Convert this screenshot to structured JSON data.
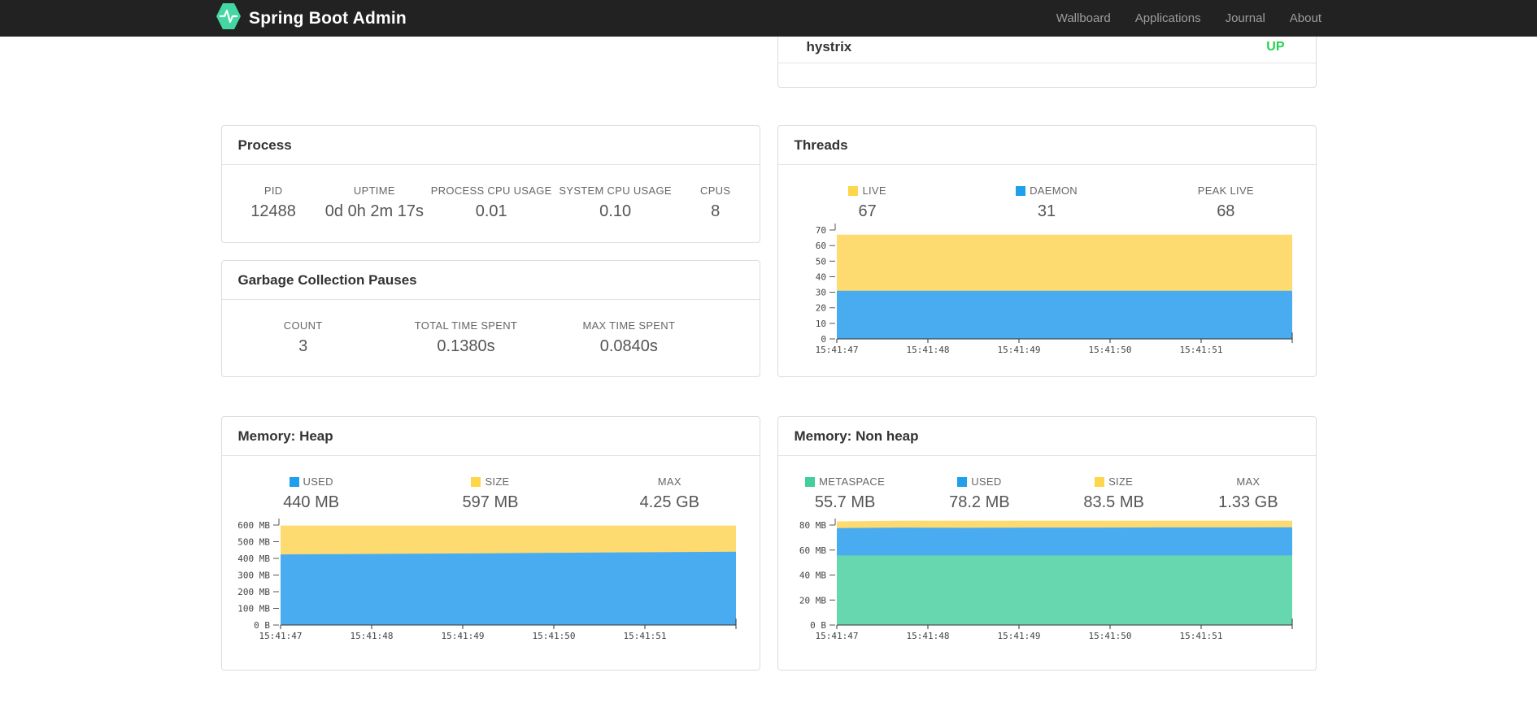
{
  "navbar": {
    "brand": "Spring Boot Admin",
    "items": [
      {
        "label": "Wallboard"
      },
      {
        "label": "Applications"
      },
      {
        "label": "Journal"
      },
      {
        "label": "About"
      }
    ]
  },
  "colors": {
    "navbar_bg": "#222222",
    "brand_green": "#45d7a2",
    "status_up": "#28d24e",
    "yellow_fill": "#fddb70",
    "yellow_legend": "#fdd64a",
    "blue_fill": "#4aacf0",
    "blue_legend": "#1fa0ec",
    "green_fill": "#66d7af",
    "green_legend": "#42cf9c"
  },
  "status_card": {
    "service": "hystrix",
    "status": "UP"
  },
  "cards": {
    "process": {
      "title": "Process",
      "stats": [
        {
          "label": "PID",
          "value": "12488"
        },
        {
          "label": "UPTIME",
          "value": "0d 0h 2m 17s"
        },
        {
          "label": "PROCESS CPU USAGE",
          "value": "0.01"
        },
        {
          "label": "SYSTEM CPU USAGE",
          "value": "0.10"
        },
        {
          "label": "CPUS",
          "value": "8"
        }
      ]
    },
    "gc": {
      "title": "Garbage Collection Pauses",
      "stats": [
        {
          "label": "COUNT",
          "value": "3"
        },
        {
          "label": "TOTAL TIME SPENT",
          "value": "0.1380s"
        },
        {
          "label": "MAX TIME SPENT",
          "value": "0.0840s"
        }
      ]
    },
    "threads": {
      "title": "Threads",
      "stats": [
        {
          "label": "LIVE",
          "value": "67",
          "color": "#fdd64a"
        },
        {
          "label": "DAEMON",
          "value": "31",
          "color": "#1fa0ec"
        },
        {
          "label": "PEAK LIVE",
          "value": "68"
        }
      ]
    },
    "heap": {
      "title": "Memory: Heap",
      "stats": [
        {
          "label": "USED",
          "value": "440 MB",
          "color": "#1fa0ec"
        },
        {
          "label": "SIZE",
          "value": "597 MB",
          "color": "#fdd64a"
        },
        {
          "label": "MAX",
          "value": "4.25 GB"
        }
      ]
    },
    "nonheap": {
      "title": "Memory: Non heap",
      "stats": [
        {
          "label": "METASPACE",
          "value": "55.7 MB",
          "color": "#42cf9c"
        },
        {
          "label": "USED",
          "value": "78.2 MB",
          "color": "#1fa0ec"
        },
        {
          "label": "SIZE",
          "value": "83.5 MB",
          "color": "#fdd64a"
        },
        {
          "label": "MAX",
          "value": "1.33 GB"
        }
      ]
    }
  },
  "chart_data": [
    {
      "id": "threads",
      "type": "area",
      "title": "Threads",
      "note": "series values are absolute top boundaries (overlapping areas), flat over time",
      "x": [
        "15:41:47",
        "15:41:48",
        "15:41:49",
        "15:41:50",
        "15:41:51"
      ],
      "ylim": [
        0,
        70
      ],
      "y_ticks": [
        "0",
        "10",
        "20",
        "30",
        "40",
        "50",
        "60",
        "70"
      ],
      "grid": false,
      "legend_position": "top",
      "series": [
        {
          "name": "DAEMON",
          "color": "#4aacf0",
          "values": [
            31,
            31,
            31,
            31,
            31,
            31,
            31,
            31
          ]
        },
        {
          "name": "LIVE",
          "color": "#fddb70",
          "values": [
            67,
            67,
            67,
            67,
            67,
            67,
            67,
            67
          ]
        }
      ]
    },
    {
      "id": "heap",
      "type": "area",
      "title": "Memory: Heap (MB)",
      "note": "series values are absolute top boundaries in MB",
      "x": [
        "15:41:47",
        "15:41:48",
        "15:41:49",
        "15:41:50",
        "15:41:51"
      ],
      "ylim": [
        0,
        600
      ],
      "y_ticks": [
        "0 B",
        "100 MB",
        "200 MB",
        "300 MB",
        "400 MB",
        "500 MB",
        "600 MB"
      ],
      "grid": false,
      "legend_position": "top",
      "series": [
        {
          "name": "USED",
          "color": "#4aacf0",
          "values": [
            424,
            426,
            428,
            430,
            433,
            435,
            438,
            440
          ]
        },
        {
          "name": "SIZE",
          "color": "#fddb70",
          "values": [
            597,
            597,
            597,
            597,
            597,
            597,
            597,
            597
          ]
        }
      ]
    },
    {
      "id": "nonheap",
      "type": "area",
      "title": "Memory: Non heap (MB)",
      "note": "series values are absolute top boundaries in MB",
      "x": [
        "15:41:47",
        "15:41:48",
        "15:41:49",
        "15:41:50",
        "15:41:51"
      ],
      "ylim": [
        0,
        80
      ],
      "y_ticks": [
        "0 B",
        "20 MB",
        "40 MB",
        "60 MB",
        "80 MB"
      ],
      "grid": false,
      "legend_position": "top",
      "series": [
        {
          "name": "METASPACE",
          "color": "#66d7af",
          "values": [
            55.7,
            55.7,
            55.7,
            55.7,
            55.7,
            55.7,
            55.7,
            55.7
          ]
        },
        {
          "name": "USED",
          "color": "#4aacf0",
          "values": [
            77.6,
            78.0,
            77.8,
            78.0,
            78.0,
            78.1,
            78.1,
            78.2
          ]
        },
        {
          "name": "SIZE",
          "color": "#fddb70",
          "values": [
            82.9,
            83.5,
            83.5,
            83.5,
            83.5,
            83.5,
            83.5,
            83.5
          ]
        }
      ]
    }
  ]
}
